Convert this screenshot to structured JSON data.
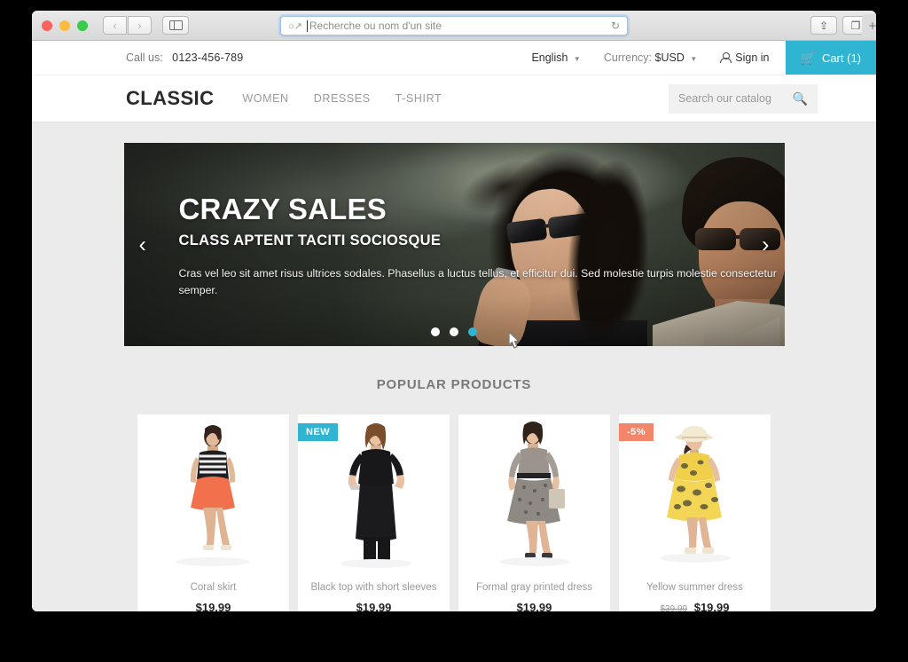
{
  "browser": {
    "window_controls": [
      "close",
      "minimize",
      "zoom"
    ],
    "back_label": "‹",
    "forward_label": "›",
    "sidebar_icon": "sidebar-icon",
    "address_placeholder": "Recherche ou nom d'un site",
    "search_icon": "search-icon",
    "reload_icon": "reload-icon",
    "share_icon": "share-icon",
    "tabs_icon": "tabs-icon",
    "new_tab_label": "+"
  },
  "topbar": {
    "call_label": "Call us:",
    "phone": "0123-456-789",
    "language": "English",
    "currency_label": "Currency:",
    "currency": "$USD",
    "signin": "Sign in",
    "cart": "Cart (1)"
  },
  "header": {
    "logo": "CLASSIC",
    "nav": [
      {
        "label": "WOMEN"
      },
      {
        "label": "DRESSES"
      },
      {
        "label": "T-SHIRT"
      }
    ],
    "search_placeholder": "Search our catalog"
  },
  "hero": {
    "title": "CRAZY SALES",
    "subtitle": "CLASS APTENT TACITI SOCIOSQUE",
    "body": "Cras vel leo sit amet risus ultrices sodales. Phasellus a luctus tellus, et efficitur dui. Sed molestie turpis molestie consectetur semper.",
    "prev_label": "‹",
    "next_label": "›",
    "slides": 3,
    "active_slide": 3
  },
  "products": {
    "section_title": "POPULAR PRODUCTS",
    "items": [
      {
        "name": "Coral skirt",
        "price": "$19.99",
        "old_price": "",
        "badge": "",
        "badge_type": ""
      },
      {
        "name": "Black top with short sleeves",
        "price": "$19.99",
        "old_price": "",
        "badge": "NEW",
        "badge_type": "new"
      },
      {
        "name": "Formal gray printed dress",
        "price": "$19.99",
        "old_price": "",
        "badge": "",
        "badge_type": ""
      },
      {
        "name": "Yellow summer dress",
        "price": "$19.99",
        "old_price": "$39.99",
        "badge": "-5%",
        "badge_type": "disc"
      }
    ]
  },
  "colors": {
    "accent_cyan": "#2fb5d2",
    "badge_orange": "#f3866a",
    "page_bg": "#ebebeb",
    "card_bg": "#ffffff"
  }
}
